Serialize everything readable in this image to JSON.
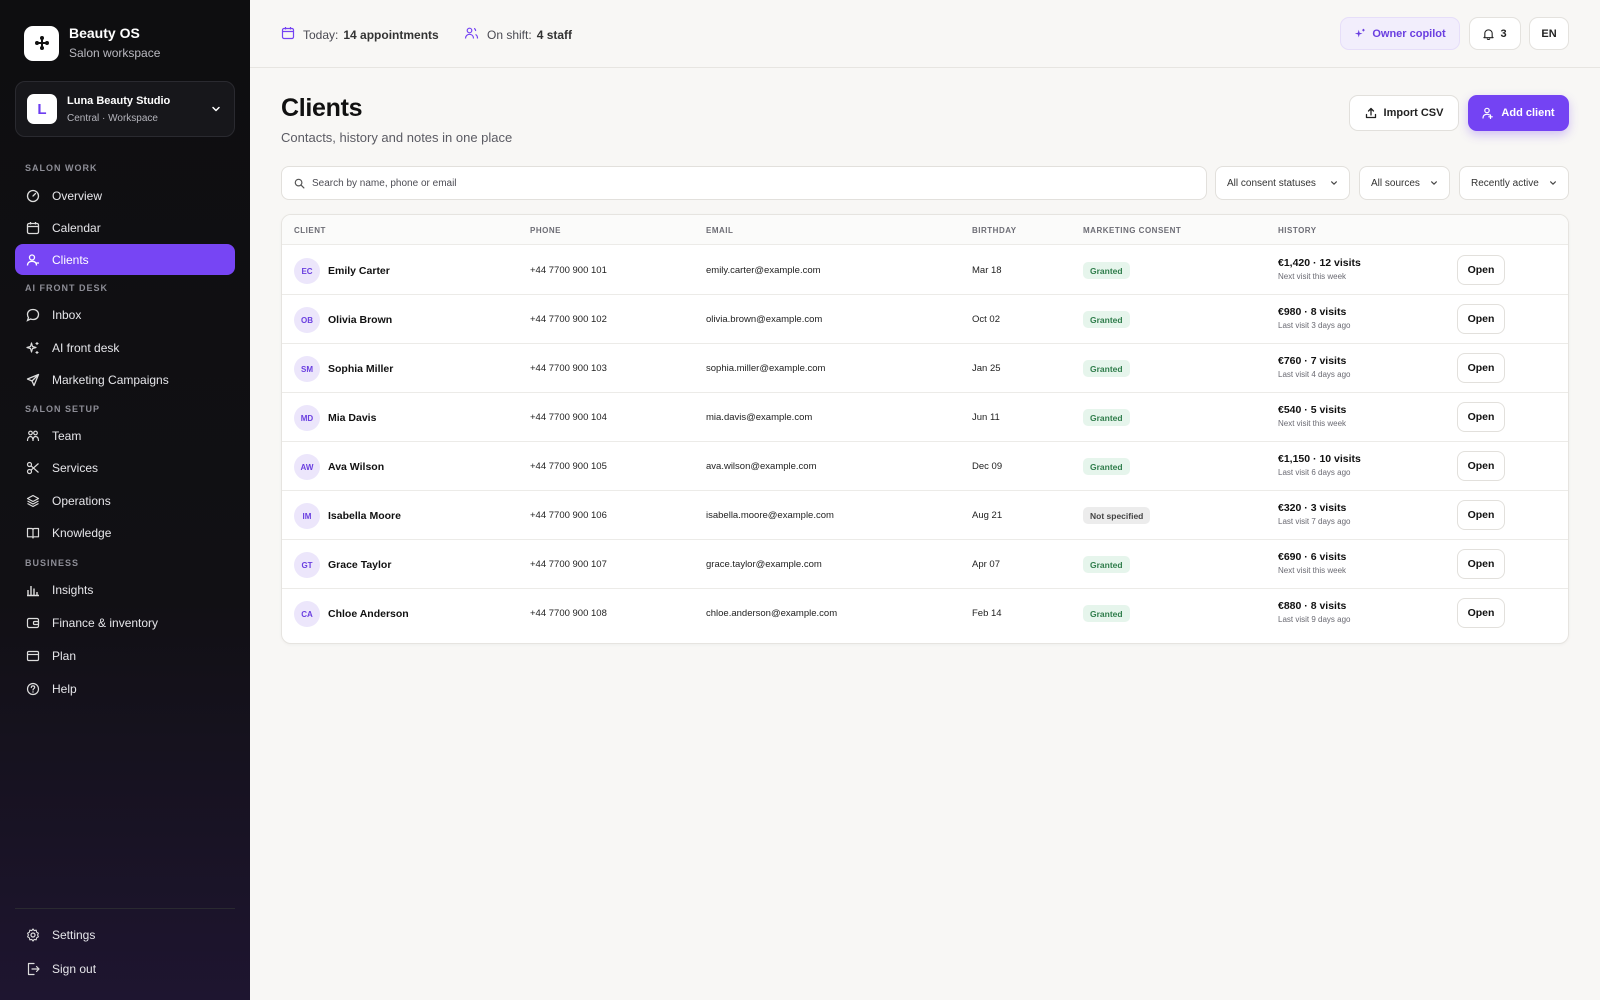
{
  "app": {
    "name": "Beauty OS",
    "subtitle": "Salon workspace"
  },
  "workspace": {
    "initial": "L",
    "name": "Luna Beauty Studio",
    "location": "Central · Workspace"
  },
  "nav": {
    "sections": [
      "SALON WORK",
      "AI FRONT DESK",
      "SALON SETUP",
      "BUSINESS"
    ],
    "items": [
      {
        "label": "Overview",
        "icon": "gauge-icon"
      },
      {
        "label": "Calendar",
        "icon": "calendar-icon"
      },
      {
        "label": "Clients",
        "icon": "user-icon",
        "active": true
      },
      {
        "label": "Inbox",
        "icon": "chat-bubble-icon"
      },
      {
        "label": "AI front desk",
        "icon": "sparkles-icon"
      },
      {
        "label": "Marketing Campaigns",
        "icon": "send-icon"
      },
      {
        "label": "Team",
        "icon": "team-icon"
      },
      {
        "label": "Services",
        "icon": "scissors-icon"
      },
      {
        "label": "Operations",
        "icon": "layers-icon"
      },
      {
        "label": "Knowledge",
        "icon": "book-icon"
      },
      {
        "label": "Insights",
        "icon": "bar-chart-icon"
      },
      {
        "label": "Finance & inventory",
        "icon": "wallet-icon"
      },
      {
        "label": "Plan",
        "icon": "plan-icon"
      },
      {
        "label": "Help",
        "icon": "help-icon"
      }
    ],
    "footer": [
      {
        "label": "Settings",
        "icon": "gear-icon"
      },
      {
        "label": "Sign out",
        "icon": "sign-out-icon"
      }
    ]
  },
  "topbar": {
    "today_label": "Today:",
    "today_value": "14 appointments",
    "shift_label": "On shift:",
    "shift_value": "4 staff",
    "copilot_label": "Owner copilot",
    "notifications_count": "3",
    "language": "EN"
  },
  "page": {
    "title": "Clients",
    "subtitle": "Contacts, history and notes in one place",
    "import_label": "Import CSV",
    "add_label": "Add client"
  },
  "search": {
    "placeholder": "Search by name, phone or email"
  },
  "filters": {
    "consent": "All consent statuses",
    "sources": "All sources",
    "sort": "Recently active"
  },
  "table": {
    "columns": [
      "CLIENT",
      "PHONE",
      "EMAIL",
      "BIRTHDAY",
      "MARKETING CONSENT",
      "HISTORY"
    ],
    "open_label": "Open",
    "rows": [
      {
        "initials": "EC",
        "name": "Emily Carter",
        "phone": "+44 7700 900 101",
        "email": "emily.carter@example.com",
        "birthday": "Mar 18",
        "consent": "Granted",
        "history": "€1,420 · 12 visits",
        "history_sub": "Next visit this week"
      },
      {
        "initials": "OB",
        "name": "Olivia Brown",
        "phone": "+44 7700 900 102",
        "email": "olivia.brown@example.com",
        "birthday": "Oct 02",
        "consent": "Granted",
        "history": "€980 · 8 visits",
        "history_sub": "Last visit 3 days ago"
      },
      {
        "initials": "SM",
        "name": "Sophia Miller",
        "phone": "+44 7700 900 103",
        "email": "sophia.miller@example.com",
        "birthday": "Jan 25",
        "consent": "Granted",
        "history": "€760 · 7 visits",
        "history_sub": "Last visit 4 days ago"
      },
      {
        "initials": "MD",
        "name": "Mia Davis",
        "phone": "+44 7700 900 104",
        "email": "mia.davis@example.com",
        "birthday": "Jun 11",
        "consent": "Granted",
        "history": "€540 · 5 visits",
        "history_sub": "Next visit this week"
      },
      {
        "initials": "AW",
        "name": "Ava Wilson",
        "phone": "+44 7700 900 105",
        "email": "ava.wilson@example.com",
        "birthday": "Dec 09",
        "consent": "Granted",
        "history": "€1,150 · 10 visits",
        "history_sub": "Last visit 6 days ago"
      },
      {
        "initials": "IM",
        "name": "Isabella Moore",
        "phone": "+44 7700 900 106",
        "email": "isabella.moore@example.com",
        "birthday": "Aug 21",
        "consent": "Not specified",
        "history": "€320 · 3 visits",
        "history_sub": "Last visit 7 days ago"
      },
      {
        "initials": "GT",
        "name": "Grace Taylor",
        "phone": "+44 7700 900 107",
        "email": "grace.taylor@example.com",
        "birthday": "Apr 07",
        "consent": "Granted",
        "history": "€690 · 6 visits",
        "history_sub": "Next visit this week"
      },
      {
        "initials": "CA",
        "name": "Chloe Anderson",
        "phone": "+44 7700 900 108",
        "email": "chloe.anderson@example.com",
        "birthday": "Feb 14",
        "consent": "Granted",
        "history": "€880 · 8 visits",
        "history_sub": "Last visit 9 days ago"
      }
    ]
  },
  "colors": {
    "accent": "#7443f3",
    "sidebar_bg": "#0e0e10",
    "granted_bg": "#e6f5ec",
    "granted_text": "#2f7d4b"
  }
}
